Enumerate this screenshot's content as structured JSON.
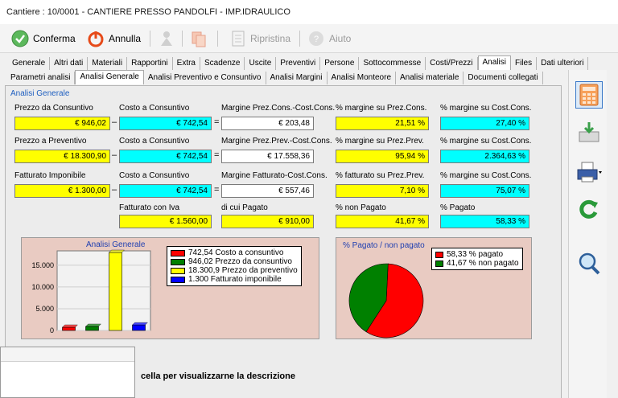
{
  "window": {
    "title": "Cantiere : 10/0001 - CANTIERE PRESSO PANDOLFI - IMP.IDRAULICO"
  },
  "toolbar": {
    "confirm_label": "Conferma",
    "cancel_label": "Annulla",
    "restore_label": "Ripristina",
    "help_label": "Aiuto"
  },
  "main_tabs": [
    "Generale",
    "Altri dati",
    "Materiali",
    "Rapportini",
    "Extra",
    "Scadenze",
    "Uscite",
    "Preventivi",
    "Persone",
    "Sottocommesse",
    "Costi/Prezzi",
    "Analisi",
    "Files",
    "Dati ulteriori"
  ],
  "main_tab_active": "Analisi",
  "sub_tabs": [
    "Parametri analisi",
    "Analisi Generale",
    "Analisi Preventivo e Consuntivo",
    "Analisi Margini",
    "Analisi Monteore",
    "Analisi materiale",
    "Documenti collegati"
  ],
  "sub_tab_active": "Analisi Generale",
  "group_title": "Analisi Generale",
  "rows": {
    "r1": {
      "l1": "Prezzo da Consuntivo",
      "v1": "€ 946,02",
      "op1": "–",
      "l2": "Costo a Consuntivo",
      "v2": "€ 742,54",
      "op2": "=",
      "l3": "Margine Prez.Cons.-Cost.Cons.",
      "v3": "€ 203,48",
      "l4": "% margine su Prez.Cons.",
      "v4": "21,51 %",
      "l5": "% margine su Cost.Cons.",
      "v5": "27,40 %"
    },
    "r2": {
      "l1": "Prezzo a Preventivo",
      "v1": "€ 18.300,90",
      "op1": "–",
      "l2": "Costo a Consuntivo",
      "v2": "€ 742,54",
      "op2": "=",
      "l3": "Margine Prez.Prev.-Cost.Cons.",
      "v3": "€ 17.558,36",
      "l4": "% margine su Prez.Prev.",
      "v4": "95,94 %",
      "l5": "% margine su Cost.Cons.",
      "v5": "2.364,63 %"
    },
    "r3": {
      "l1": "Fatturato Imponibile",
      "v1": "€ 1.300,00",
      "op1": "–",
      "l2": "Costo a Consuntivo",
      "v2": "€ 742,54",
      "op2": "=",
      "l3": "Margine Fatturato-Cost.Cons.",
      "v3": "€ 557,46",
      "l4": "% fatturato su Prez.Prev.",
      "v4": "7,10 %",
      "l5": "% margine su Cost.Cons.",
      "v5": "75,07 %"
    },
    "r4": {
      "l2": "Fatturato con Iva",
      "v2": "€ 1.560,00",
      "l3": "di cui Pagato",
      "v3": "€ 910,00",
      "l4": "% non Pagato",
      "v4": "41,67 %",
      "l5": "% Pagato",
      "v5": "58,33 %"
    }
  },
  "status_text": "cella per visualizzarne la descrizione",
  "chart_data": [
    {
      "type": "bar",
      "title": "Analisi Generale",
      "categories": [
        "Costo a consuntivo",
        "Prezzo da consuntivo",
        "Prezzo da preventivo",
        "Fatturato imponibile"
      ],
      "values": [
        742.54,
        946.02,
        18300.9,
        1300
      ],
      "colors": [
        "#ff0000",
        "#008000",
        "#ffff00",
        "#0000ff"
      ],
      "legend": [
        "742,54 Costo a consuntivo",
        "946,02 Prezzo da consuntivo",
        "18.300,9 Prezzo da preventivo",
        "1.300 Fatturato imponibile"
      ],
      "ylim": [
        0,
        18300.9
      ],
      "yticks": [
        "0",
        "5.000",
        "10.000",
        "15.000"
      ],
      "legend_position": "top-right"
    },
    {
      "type": "pie",
      "title": "% Pagato / non pagato",
      "categories": [
        "% pagato",
        "% non pagato"
      ],
      "values": [
        58.33,
        41.67
      ],
      "colors": [
        "#ff0000",
        "#008000"
      ],
      "legend": [
        "58,33 % pagato",
        "41,67 % non pagato"
      ],
      "legend_position": "top-right"
    }
  ],
  "icons": {
    "confirm": "check-circle-icon",
    "cancel": "power-icon",
    "wizard": "wizard-icon",
    "copy": "copy-icon",
    "restore": "document-icon",
    "help": "help-icon",
    "calculator": "calculator-icon",
    "export": "tray-download-icon",
    "print": "printer-icon",
    "refresh": "refresh-icon",
    "zoom": "magnifier-icon"
  }
}
